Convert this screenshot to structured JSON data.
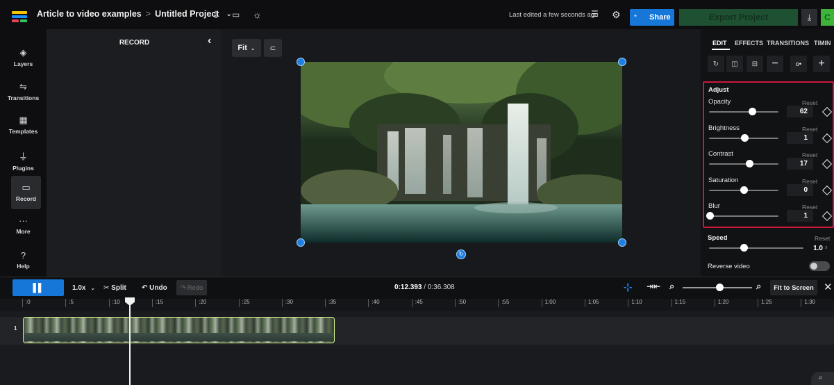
{
  "header": {
    "project_folder": "Article to video examples",
    "breadcrumb_sep": ">",
    "project_name": "Untitled Project",
    "last_edited": "Last edited a few seconds ago",
    "share_label": "Share",
    "export_label": "Export Project",
    "download_icon": "download-icon",
    "extra_label": "C"
  },
  "sidebar": {
    "items": [
      {
        "label": "Layers",
        "icon": "layers-icon"
      },
      {
        "label": "Transitions",
        "icon": "transitions-icon"
      },
      {
        "label": "Templates",
        "icon": "templates-icon"
      },
      {
        "label": "Plugins",
        "icon": "plugins-icon"
      },
      {
        "label": "Record",
        "icon": "record-icon"
      },
      {
        "label": "More",
        "icon": "more-icon"
      },
      {
        "label": "Help",
        "icon": "help-icon"
      }
    ]
  },
  "record_panel": {
    "title": "RECORD"
  },
  "canvas": {
    "fit_label": "Fit"
  },
  "properties": {
    "tabs": [
      "EDIT",
      "EFFECTS",
      "TRANSITIONS",
      "TIMIN"
    ],
    "adjust_title": "Adjust",
    "reset_label": "Reset",
    "controls": [
      {
        "label": "Opacity",
        "value": "62",
        "level": 0.62
      },
      {
        "label": "Brightness",
        "value": "1",
        "level": 0.51
      },
      {
        "label": "Contrast",
        "value": "17",
        "level": 0.58
      },
      {
        "label": "Saturation",
        "value": "0",
        "level": 0.5
      },
      {
        "label": "Blur",
        "value": "1",
        "level": 0.01
      }
    ],
    "speed": {
      "label": "Speed",
      "value": "1.0",
      "unit": "x",
      "level": 0.37
    },
    "reverse_label": "Reverse video"
  },
  "timeline": {
    "speed_label": "1.0x",
    "split_label": "Split",
    "undo_label": "Undo",
    "redo_label": "Redo",
    "current_time": "0:12.393",
    "total_time": "/ 0:36.308",
    "fit_screen_label": "Fit to Screen",
    "zoom_level": 0.55,
    "track_number": "1",
    "ticks": [
      ":0",
      ":5",
      ":10",
      ":15",
      ":20",
      ":25",
      ":30",
      ":35",
      ":40",
      ":45",
      ":50",
      ":55",
      "1:00",
      "1:05",
      "1:10",
      "1:15",
      "1:20",
      "1:25",
      "1:30"
    ]
  },
  "colors": {
    "accent": "#1677d9",
    "highlight": "#c8183c",
    "export_bg": "#1d5131",
    "clip_border": "#d9f28a"
  }
}
